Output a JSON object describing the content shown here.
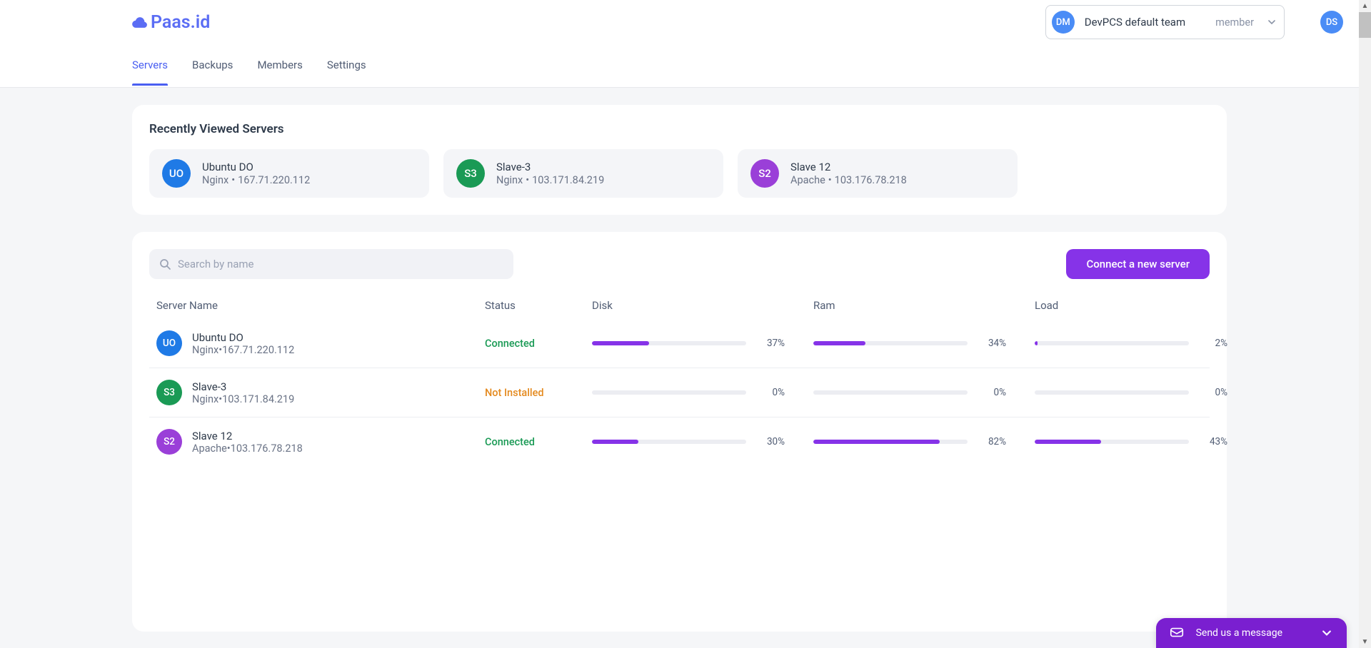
{
  "brand": {
    "name": "Paas.id"
  },
  "header": {
    "team_avatar": "DM",
    "team_name": "DevPCS default team",
    "team_role": "member",
    "user_avatar": "DS"
  },
  "tabs": [
    {
      "label": "Servers",
      "active": true
    },
    {
      "label": "Backups",
      "active": false
    },
    {
      "label": "Members",
      "active": false
    },
    {
      "label": "Settings",
      "active": false
    }
  ],
  "recent": {
    "title": "Recently Viewed Servers",
    "items": [
      {
        "avatar": "UO",
        "avatar_color": "blue",
        "name": "Ubuntu DO",
        "engine": "Nginx",
        "ip": "167.71.220.112"
      },
      {
        "avatar": "S3",
        "avatar_color": "green",
        "name": "Slave-3",
        "engine": "Nginx",
        "ip": "103.171.84.219"
      },
      {
        "avatar": "S2",
        "avatar_color": "purple",
        "name": "Slave 12",
        "engine": "Apache",
        "ip": "103.176.78.218"
      }
    ]
  },
  "search": {
    "placeholder": "Search by name"
  },
  "actions": {
    "connect_label": "Connect a new server"
  },
  "table": {
    "columns": {
      "server": "Server Name",
      "status": "Status",
      "disk": "Disk",
      "ram": "Ram",
      "load": "Load"
    },
    "rows": [
      {
        "avatar": "UO",
        "avatar_color": "blue",
        "name": "Ubuntu DO",
        "engine": "Nginx",
        "ip": "167.71.220.112",
        "status": "Connected",
        "status_class": "connected",
        "disk": {
          "pct": 37,
          "label": "37%"
        },
        "ram": {
          "pct": 34,
          "label": "34%"
        },
        "load": {
          "pct": 2,
          "label": "2%"
        }
      },
      {
        "avatar": "S3",
        "avatar_color": "green",
        "name": "Slave-3",
        "engine": "Nginx",
        "ip": "103.171.84.219",
        "status": "Not Installed",
        "status_class": "notinstalled",
        "disk": {
          "pct": 0,
          "label": "0%"
        },
        "ram": {
          "pct": 0,
          "label": "0%"
        },
        "load": {
          "pct": 0,
          "label": "0%"
        }
      },
      {
        "avatar": "S2",
        "avatar_color": "purple",
        "name": "Slave 12",
        "engine": "Apache",
        "ip": "103.176.78.218",
        "status": "Connected",
        "status_class": "connected",
        "disk": {
          "pct": 30,
          "label": "30%"
        },
        "ram": {
          "pct": 82,
          "label": "82%"
        },
        "load": {
          "pct": 43,
          "label": "43%"
        }
      }
    ]
  },
  "chat": {
    "label": "Send us a message"
  },
  "colors": {
    "accent": "#8633e8",
    "link": "#4a5ff1",
    "success": "#1a9a55",
    "warn": "#e48a1f"
  }
}
